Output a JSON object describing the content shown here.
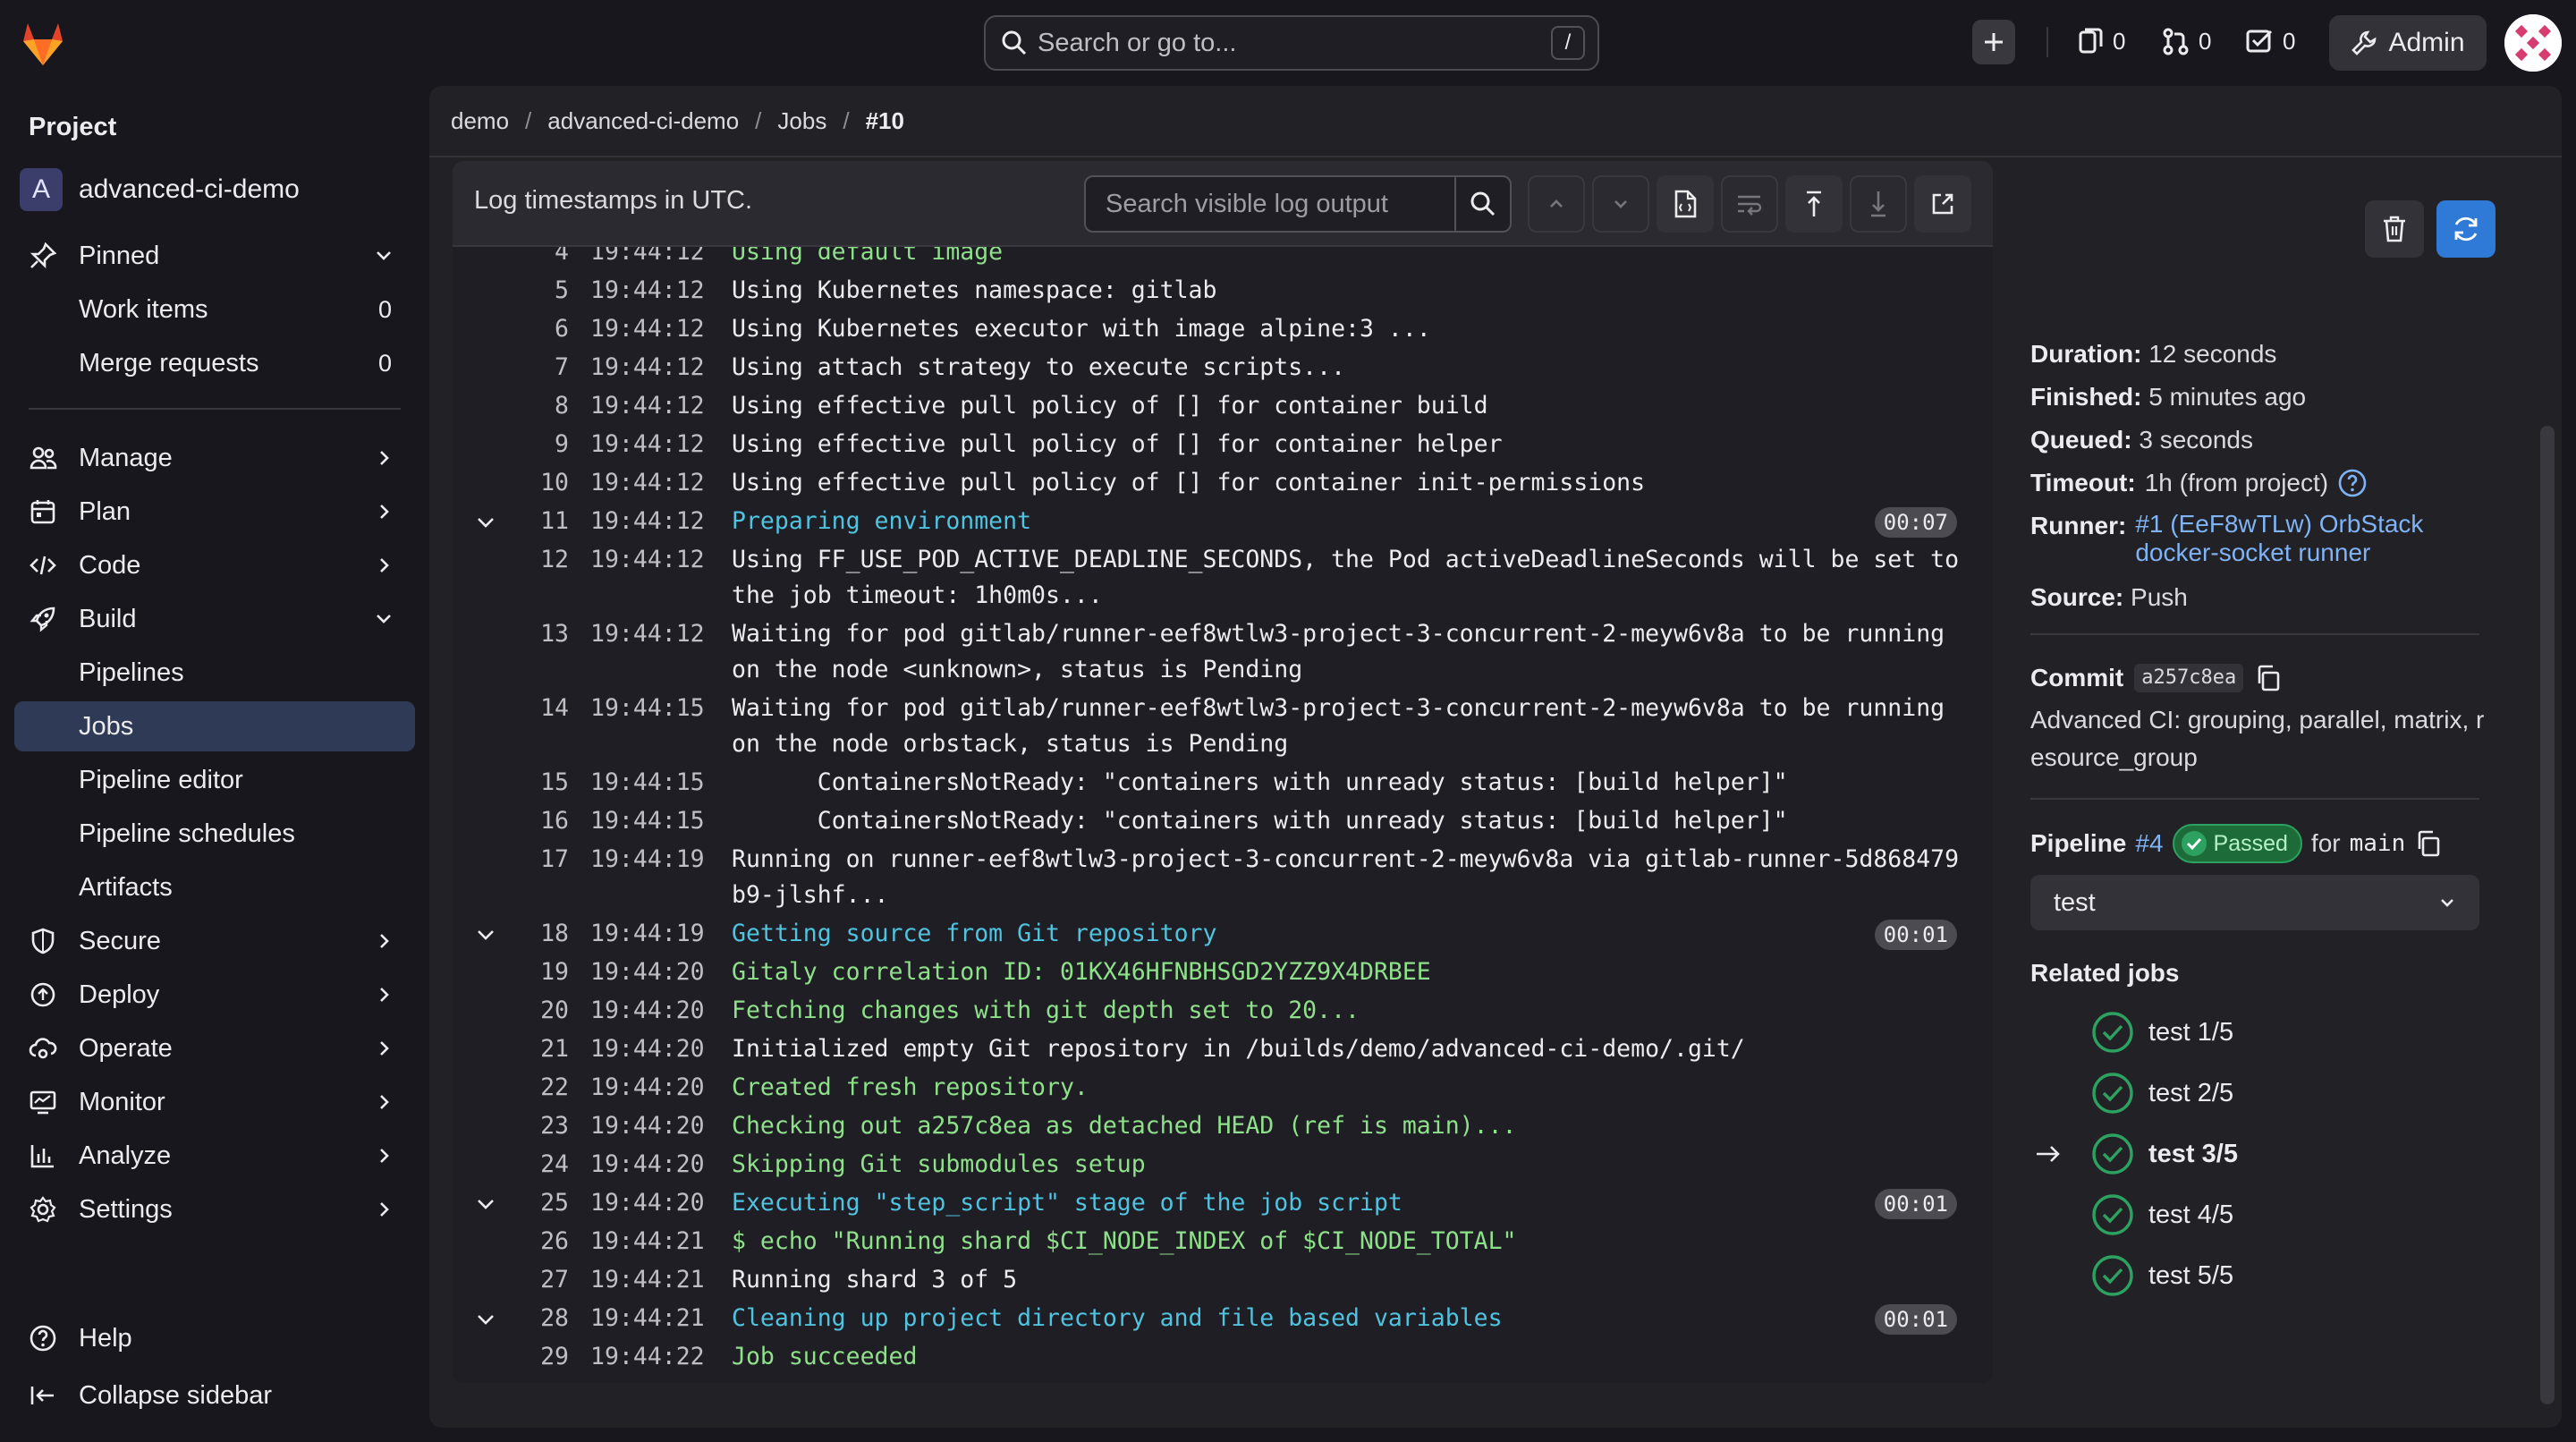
{
  "topbar": {
    "search_placeholder": "Search or go to...",
    "search_shortcut": "/",
    "issues_count": "0",
    "merge_requests_count": "0",
    "todos_count": "0",
    "admin_label": "Admin"
  },
  "sidebar": {
    "section_title": "Project",
    "project_initial": "A",
    "project_name": "advanced-ci-demo",
    "pinned_label": "Pinned",
    "pinned_items": [
      {
        "label": "Work items",
        "count": "0"
      },
      {
        "label": "Merge requests",
        "count": "0"
      }
    ],
    "nav": [
      {
        "label": "Manage"
      },
      {
        "label": "Plan"
      },
      {
        "label": "Code"
      },
      {
        "label": "Build"
      }
    ],
    "build_items": [
      {
        "label": "Pipelines"
      },
      {
        "label": "Jobs"
      },
      {
        "label": "Pipeline editor"
      },
      {
        "label": "Pipeline schedules"
      },
      {
        "label": "Artifacts"
      }
    ],
    "nav2": [
      {
        "label": "Secure"
      },
      {
        "label": "Deploy"
      },
      {
        "label": "Operate"
      },
      {
        "label": "Monitor"
      },
      {
        "label": "Analyze"
      },
      {
        "label": "Settings"
      }
    ],
    "help_label": "Help",
    "collapse_label": "Collapse sidebar"
  },
  "breadcrumb": [
    "demo",
    "advanced-ci-demo",
    "Jobs",
    "#10"
  ],
  "log": {
    "timezone_note": "Log timestamps in UTC.",
    "search_placeholder": "Search visible log output",
    "lines": [
      {
        "n": "4",
        "t": "19:44:12",
        "text": "Using default image",
        "c": "green"
      },
      {
        "n": "5",
        "t": "19:44:12",
        "text": "Using Kubernetes namespace: gitlab",
        "c": ""
      },
      {
        "n": "6",
        "t": "19:44:12",
        "text": "Using Kubernetes executor with image alpine:3 ...",
        "c": ""
      },
      {
        "n": "7",
        "t": "19:44:12",
        "text": "Using attach strategy to execute scripts...",
        "c": ""
      },
      {
        "n": "8",
        "t": "19:44:12",
        "text": "Using effective pull policy of [] for container build",
        "c": ""
      },
      {
        "n": "9",
        "t": "19:44:12",
        "text": "Using effective pull policy of [] for container helper",
        "c": ""
      },
      {
        "n": "10",
        "t": "19:44:12",
        "text": "Using effective pull policy of [] for container init-permissions",
        "c": ""
      },
      {
        "n": "11",
        "t": "19:44:12",
        "text": "Preparing environment",
        "c": "cyan",
        "section": true,
        "dur": "00:07"
      },
      {
        "n": "12",
        "t": "19:44:12",
        "text": "Using FF_USE_POD_ACTIVE_DEADLINE_SECONDS, the Pod activeDeadlineSeconds will be set to the job timeout: 1h0m0s...",
        "c": ""
      },
      {
        "n": "13",
        "t": "19:44:12",
        "text": "Waiting for pod gitlab/runner-eef8wtlw3-project-3-concurrent-2-meyw6v8a to be running on the node <unknown>, status is Pending",
        "c": ""
      },
      {
        "n": "14",
        "t": "19:44:15",
        "text": "Waiting for pod gitlab/runner-eef8wtlw3-project-3-concurrent-2-meyw6v8a to be running on the node orbstack, status is Pending",
        "c": ""
      },
      {
        "n": "15",
        "t": "19:44:15",
        "text": "      ContainersNotReady: \"containers with unready status: [build helper]\"",
        "c": ""
      },
      {
        "n": "16",
        "t": "19:44:15",
        "text": "      ContainersNotReady: \"containers with unready status: [build helper]\"",
        "c": ""
      },
      {
        "n": "17",
        "t": "19:44:19",
        "text": "Running on runner-eef8wtlw3-project-3-concurrent-2-meyw6v8a via gitlab-runner-5d868479b9-jlshf...",
        "c": ""
      },
      {
        "n": "18",
        "t": "19:44:19",
        "text": "Getting source from Git repository",
        "c": "cyan",
        "section": true,
        "dur": "00:01"
      },
      {
        "n": "19",
        "t": "19:44:20",
        "text": "Gitaly correlation ID: 01KX46HFNBHSGD2YZZ9X4DRBEE",
        "c": "green"
      },
      {
        "n": "20",
        "t": "19:44:20",
        "text": "Fetching changes with git depth set to 20...",
        "c": "green"
      },
      {
        "n": "21",
        "t": "19:44:20",
        "text": "Initialized empty Git repository in /builds/demo/advanced-ci-demo/.git/",
        "c": ""
      },
      {
        "n": "22",
        "t": "19:44:20",
        "text": "Created fresh repository.",
        "c": "green"
      },
      {
        "n": "23",
        "t": "19:44:20",
        "text": "Checking out a257c8ea as detached HEAD (ref is main)...",
        "c": "green"
      },
      {
        "n": "24",
        "t": "19:44:20",
        "text": "Skipping Git submodules setup",
        "c": "green"
      },
      {
        "n": "25",
        "t": "19:44:20",
        "text": "Executing \"step_script\" stage of the job script",
        "c": "cyan",
        "section": true,
        "dur": "00:01"
      },
      {
        "n": "26",
        "t": "19:44:21",
        "text": "$ echo \"Running shard $CI_NODE_INDEX of $CI_NODE_TOTAL\"",
        "c": "green"
      },
      {
        "n": "27",
        "t": "19:44:21",
        "text": "Running shard 3 of 5",
        "c": ""
      },
      {
        "n": "28",
        "t": "19:44:21",
        "text": "Cleaning up project directory and file based variables",
        "c": "cyan",
        "section": true,
        "dur": "00:01"
      },
      {
        "n": "29",
        "t": "19:44:22",
        "text": "Job succeeded",
        "c": "green"
      }
    ]
  },
  "job": {
    "duration_label": "Duration:",
    "duration": "12 seconds",
    "finished_label": "Finished:",
    "finished": "5 minutes ago",
    "queued_label": "Queued:",
    "queued": "3 seconds",
    "timeout_label": "Timeout:",
    "timeout": "1h (from project)",
    "runner_label": "Runner:",
    "runner": "#1 (EeF8wTLw) OrbStack docker-socket runner",
    "source_label": "Source:",
    "source": "Push",
    "commit_label": "Commit",
    "commit_sha": "a257c8ea",
    "commit_message": "Advanced CI: grouping, parallel, matrix, resource_group",
    "pipeline_label": "Pipeline",
    "pipeline_id": "#4",
    "pipeline_status": "Passed",
    "pipeline_for": "for",
    "pipeline_ref": "main",
    "stage_select": "test",
    "related_title": "Related jobs",
    "related": [
      {
        "label": "test 1/5",
        "current": false
      },
      {
        "label": "test 2/5",
        "current": false
      },
      {
        "label": "test 3/5",
        "current": true
      },
      {
        "label": "test 4/5",
        "current": false
      },
      {
        "label": "test 5/5",
        "current": false
      }
    ]
  },
  "colors": {
    "accent": "#7fb3f5",
    "success": "#2da160",
    "log_green": "#8fe08a",
    "log_cyan": "#4fc3e0"
  }
}
